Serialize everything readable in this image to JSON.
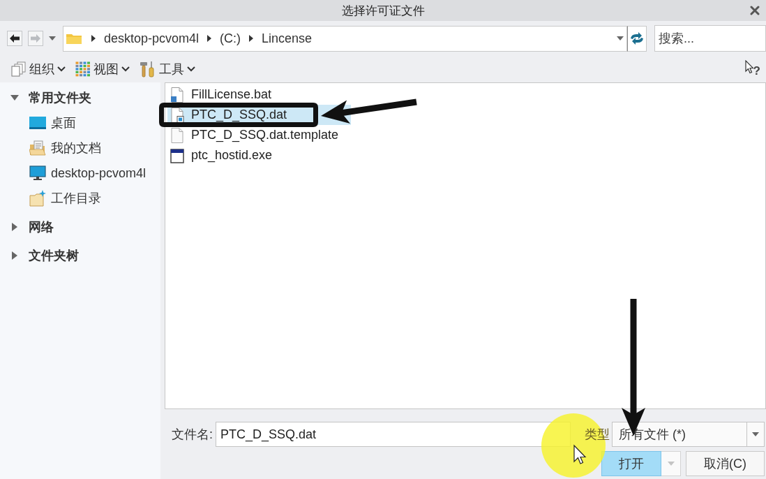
{
  "window": {
    "title": "选择许可证文件"
  },
  "navigation": [
    {
      "kind": "back",
      "disabled": false
    },
    {
      "kind": "forward",
      "disabled": true
    }
  ],
  "address_bar": {
    "path": [
      "desktop-pcvom4l",
      "(C:)",
      "Lincense"
    ]
  },
  "search": {
    "placeholder": "搜索..."
  },
  "toolbar": [
    {
      "label": "组织",
      "kind": "organize"
    },
    {
      "label": "视图",
      "kind": "view"
    },
    {
      "label": "工具",
      "kind": "tools"
    }
  ],
  "help_button": {
    "label": "?"
  },
  "sidebar": [
    {
      "label": "常用文件夹",
      "expanded": true,
      "children": [
        {
          "label": "桌面",
          "kind": "desktop"
        },
        {
          "label": "我的文档",
          "kind": "documents"
        },
        {
          "label": "desktop-pcvom4l",
          "kind": "computer"
        },
        {
          "label": "工作目录",
          "kind": "workdir"
        }
      ]
    },
    {
      "label": "网络",
      "expanded": false
    },
    {
      "label": "文件夹树",
      "expanded": false
    }
  ],
  "files": [
    {
      "name": "FillLicense.bat",
      "kind": "script",
      "selected": false
    },
    {
      "name": "PTC_D_SSQ.dat",
      "kind": "data",
      "selected": true
    },
    {
      "name": "PTC_D_SSQ.dat.template",
      "kind": "template",
      "selected": false
    },
    {
      "name": "ptc_hostid.exe",
      "kind": "program",
      "selected": false
    }
  ],
  "filename": {
    "label": "文件名:",
    "value": "PTC_D_SSQ.dat"
  },
  "file_type": {
    "label": "类型",
    "value": "所有文件 (*)"
  },
  "buttons": [
    {
      "label": "打开",
      "kind": "split",
      "default": true
    },
    {
      "label": "取消(C)",
      "kind": "plain",
      "default": false
    }
  ],
  "annotations": [
    {
      "kind": "frame"
    },
    {
      "kind": "arrow"
    },
    {
      "kind": "arrow"
    },
    {
      "kind": "spotlight"
    },
    {
      "kind": "pointer"
    }
  ]
}
